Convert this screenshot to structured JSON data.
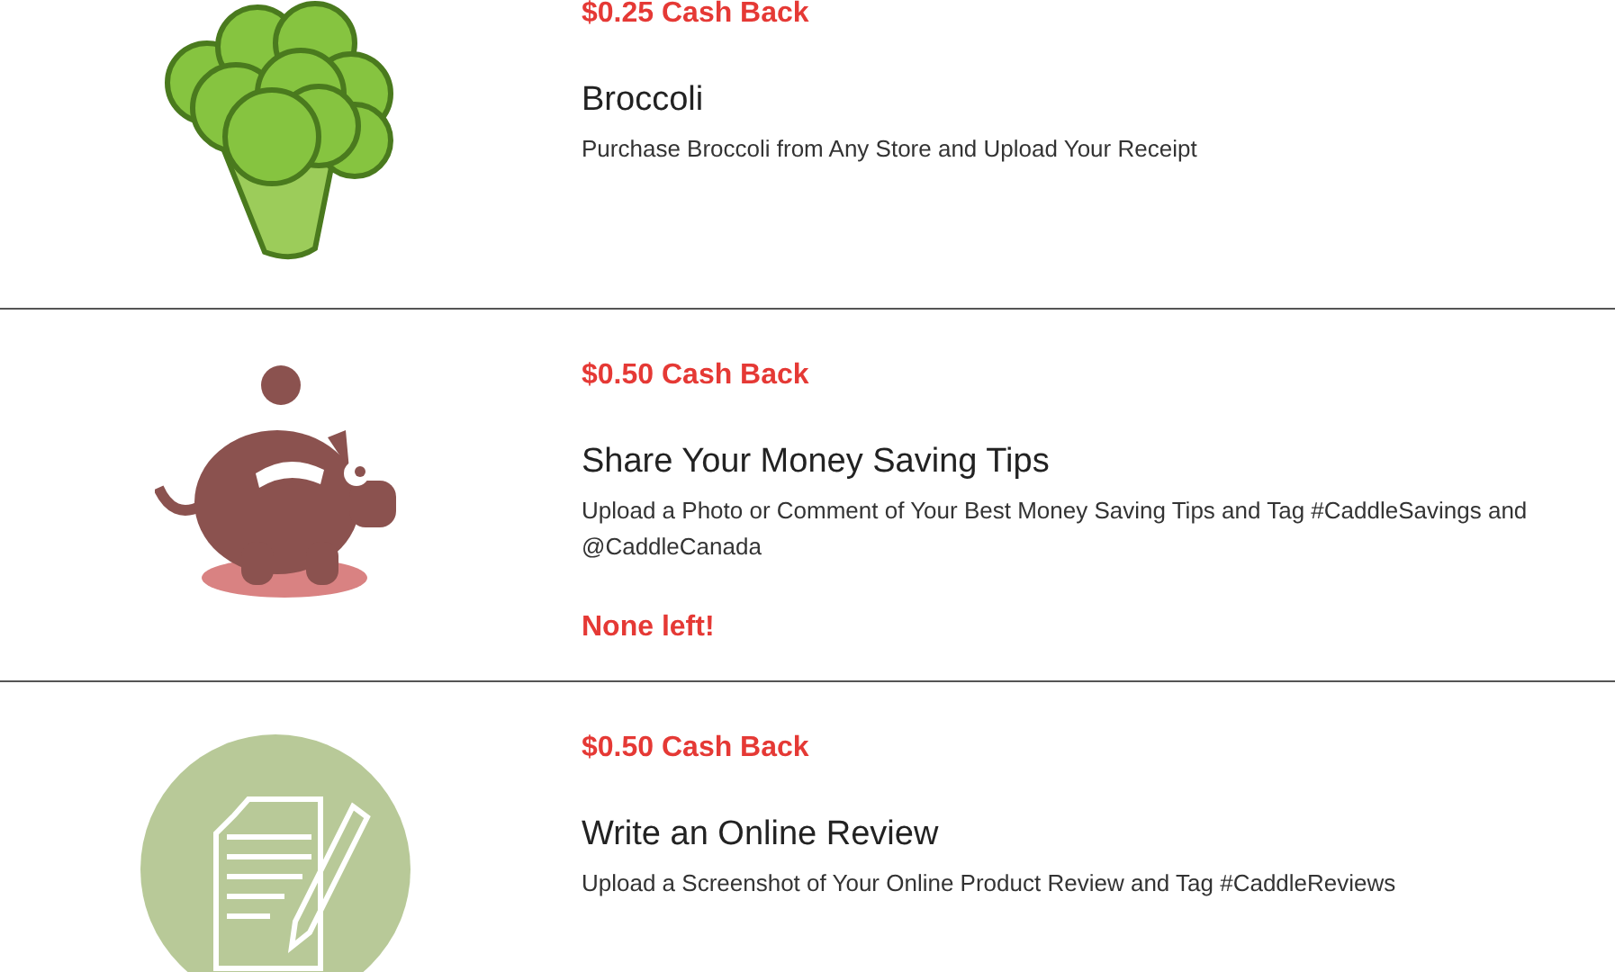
{
  "offers": [
    {
      "kind": "broccoli",
      "cash_back": "$0.25 Cash Back",
      "title": "Broccoli",
      "description": "Purchase Broccoli from Any Store and Upload Your Receipt"
    },
    {
      "kind": "piggy-bank",
      "cash_back": "$0.50 Cash Back",
      "title": "Share Your Money Saving Tips",
      "description": "Upload a Photo or Comment of Your Best Money Saving Tips and Tag #CaddleSavings and @CaddleCanada",
      "status": "None left!"
    },
    {
      "kind": "document",
      "cash_back": "$0.50 Cash Back",
      "title": "Write an Online Review",
      "description": "Upload a Screenshot of Your Online Product Review and Tag #CaddleReviews"
    }
  ]
}
